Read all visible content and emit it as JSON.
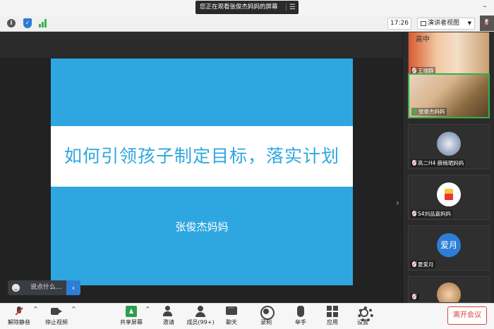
{
  "banner": {
    "text": "您正在观看张俊杰妈妈的屏幕",
    "menu_icon": "menu-icon"
  },
  "info": {
    "time": "17:26",
    "view_mode": "演讲者视图"
  },
  "slide": {
    "title": "如何引领孩子制定目标，落实计划",
    "author": "张俊杰妈妈",
    "colors": {
      "background": "#2ea7e0",
      "band": "#ffffff"
    }
  },
  "chat": {
    "placeholder": "说点什么..."
  },
  "participants": [
    {
      "name": "王瑞群",
      "overlay": "高中",
      "mic": "muted"
    },
    {
      "name": "张俊杰妈妈",
      "mic": "speaking"
    },
    {
      "name": "高二H4 薛楠珺妈妈",
      "mic": "muted"
    },
    {
      "name": "S4刘品嘉妈妈",
      "mic": "muted"
    },
    {
      "name": "夏爱月",
      "avatar_text": "爱月",
      "mic": "muted"
    }
  ],
  "toolbar": {
    "unmute": "解除静音",
    "stop_video": "停止视频",
    "share": "共享屏幕",
    "invite": "邀请",
    "members": "成员(99+)",
    "chat": "聊天",
    "record": "录制",
    "raise_hand": "举手",
    "apps": "应用",
    "settings": "设置",
    "leave": "离开会议"
  },
  "accent_colors": {
    "leave": "#e04040",
    "active_speaker": "#2fb24a",
    "share": "#2e9e4f"
  }
}
